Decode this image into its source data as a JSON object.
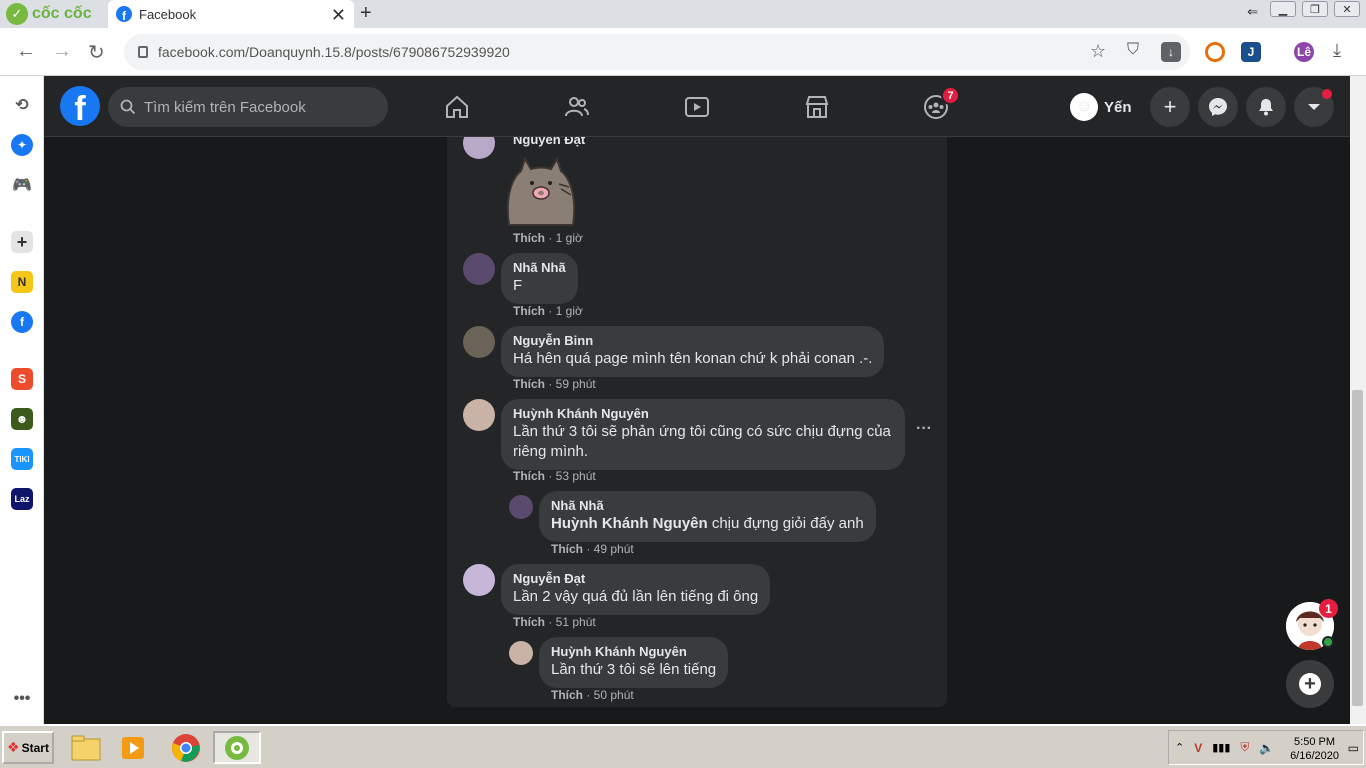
{
  "browser": {
    "brand": "cốc cốc",
    "tab_title": "Facebook",
    "url": "facebook.com/Doanquynh.15.8/posts/679086752939920",
    "profile_initials": "Lê"
  },
  "facebook": {
    "search_placeholder": "Tìm kiếm trên Facebook",
    "groups_badge": "7",
    "user_name": "Yến"
  },
  "comments": [
    {
      "name": "Nguyễn Đạt",
      "text": "",
      "sticker": "pusheen-cat-sticker",
      "action": "Thích",
      "time": "1 giờ"
    },
    {
      "name": "Nhã Nhã",
      "text": "F",
      "action": "Thích",
      "time": "1 giờ"
    },
    {
      "name": "Nguyễn Binn",
      "text": "Há hên quá page mình tên konan chứ k phải conan .-.",
      "action": "Thích",
      "time": "59 phút"
    },
    {
      "name": "Huỳnh Khánh Nguyên",
      "text": "Lần thứ 3 tôi sẽ phản ứng tôi cũng có sức chịu đựng của riêng mình.",
      "action": "Thích",
      "time": "53 phút"
    },
    {
      "name": "Nhã Nhã",
      "mention": "Huỳnh Khánh Nguyên",
      "text": " chịu đựng giỏi đấy anh",
      "action": "Thích",
      "time": "49 phút"
    },
    {
      "name": "Nguyễn Đạt",
      "text": "Lần 2 vậy quá đủ lần lên tiếng đi ông",
      "action": "Thích",
      "time": "51 phút"
    },
    {
      "name": "Huỳnh Khánh Nguyên",
      "text": "Lần thứ 3 tôi sẽ lên tiếng",
      "action": "Thích",
      "time": "50 phút"
    }
  ],
  "chat_badge": "1",
  "taskbar": {
    "start_label": "Start",
    "time": "5:50 PM",
    "date": "6/16/2020"
  },
  "colors": {
    "fb_blue": "#1877f2",
    "bg": "#18191a",
    "card": "#242526",
    "bubble": "#3a3b3c",
    "badge_red": "#e41e3f"
  }
}
